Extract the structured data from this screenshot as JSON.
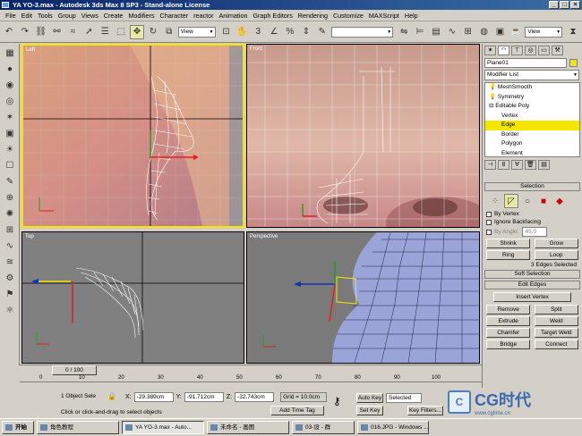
{
  "window": {
    "title": "YA YO-3.max - Autodesk 3ds Max 8 SP3  - Stand-alone License"
  },
  "menu": [
    "File",
    "Edit",
    "Tools",
    "Group",
    "Views",
    "Create",
    "Modifiers",
    "Character",
    "reactor",
    "Animation",
    "Graph Editors",
    "Rendering",
    "Customize",
    "MAXScript",
    "Help"
  ],
  "toolbar": {
    "ref_coord": "View"
  },
  "viewports": {
    "left": "Left",
    "front": "Front",
    "top": "Top",
    "perspective": "Perspective"
  },
  "panel": {
    "object_name": "Plane01",
    "modifier_list": "Modifier List",
    "stack": [
      "MeshSmooth",
      "Symmetry",
      "Editable Poly",
      "Vertex",
      "Edge",
      "Border",
      "Polygon",
      "Element"
    ],
    "selection_title": "Selection",
    "by_vertex": "By Vertex",
    "ignore_backfacing": "Ignore Backfacing",
    "by_angle": "By Angle:",
    "by_angle_value": "45.0",
    "shrink": "Shrink",
    "grow": "Grow",
    "ring": "Ring",
    "loop": "Loop",
    "selected_info": "3 Edges Selected",
    "soft_selection": "Soft Selection",
    "edit_edges": "Edit Edges",
    "insert_vertex": "Insert Vertex",
    "remove": "Remove",
    "split": "Split",
    "extrude": "Extrude",
    "weld": "Weld",
    "chamfer": "Chamfer",
    "target_weld": "Target Weld",
    "bridge": "Bridge",
    "connect": "Connect"
  },
  "timeline": {
    "frame": "0 / 100",
    "ticks": [
      "0",
      "10",
      "20",
      "30",
      "40",
      "50",
      "60",
      "70",
      "80",
      "90",
      "100"
    ]
  },
  "status": {
    "objects": "1 Object Sele",
    "x": "-29.389cm",
    "y": "-91.712cm",
    "z": "-32.743cm",
    "grid": "Grid = 10.0cm",
    "prompt": "Click or click-and-drag to select objects",
    "add_time_tag": "Add Time Tag",
    "auto_key": "Auto Key",
    "set_key": "Set Key",
    "selected": "Selected",
    "key_filters": "Key Filters..."
  },
  "taskbar": [
    "开始",
    "角色教程",
    "YA YO-3.max - Auto...",
    "未命名 - 画图",
    "03-设 - 群",
    "016.JPG - Windows ..."
  ],
  "watermark": {
    "brand": "CG时代",
    "url": "www.cgtime.cn"
  },
  "colors": {
    "highlight": "#f5e600",
    "viewport_bg": "#808080",
    "title_bg": "#0a246a"
  }
}
